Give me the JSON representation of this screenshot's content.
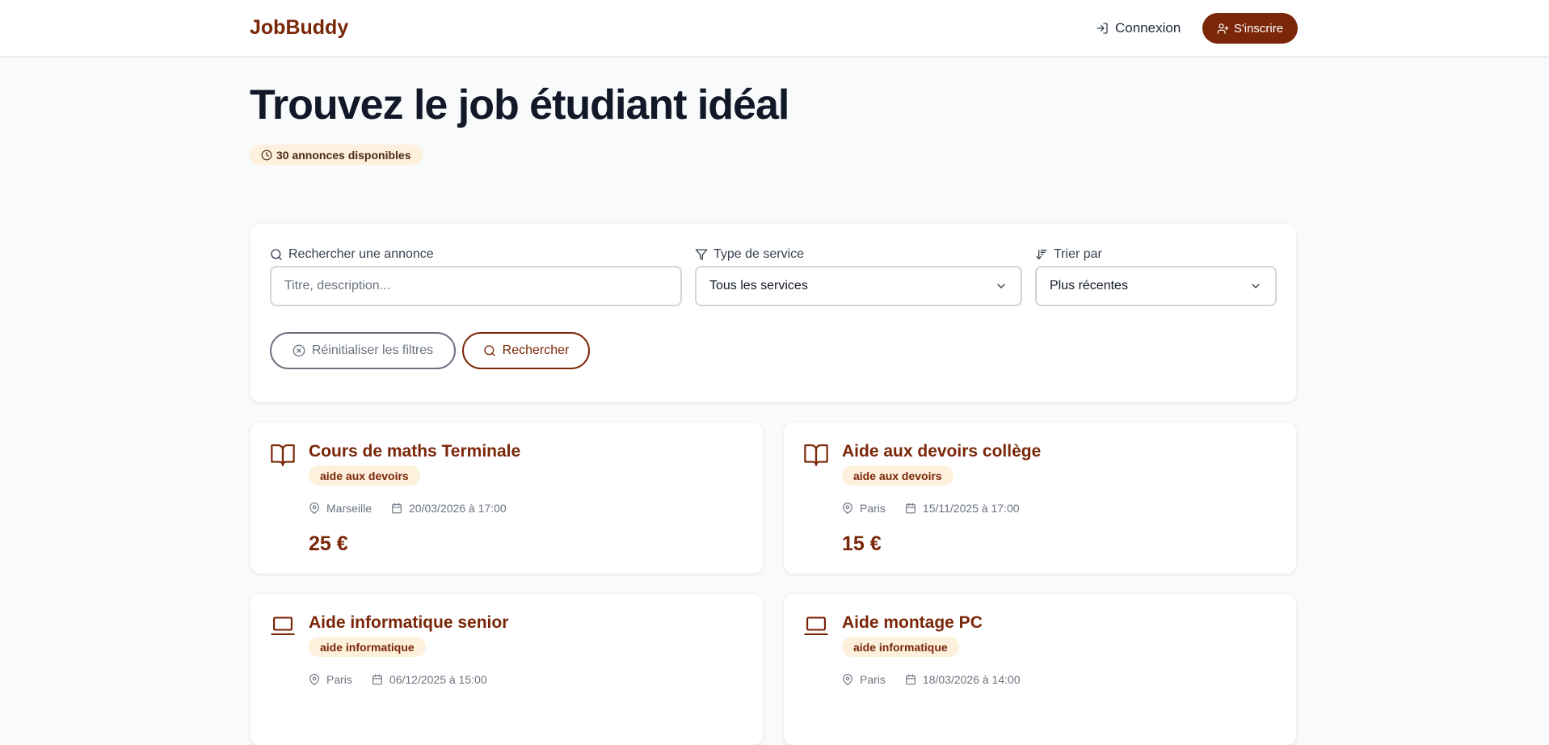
{
  "brand": "JobBuddy",
  "nav": {
    "login_label": "Connexion",
    "signup_label": "S'inscrire"
  },
  "hero": {
    "title": "Trouvez le job étudiant idéal",
    "count_badge": "30 annonces disponibles"
  },
  "filters": {
    "search_label": "Rechercher une annonce",
    "search_placeholder": "Titre, description...",
    "type_label": "Type de service",
    "type_value": "Tous les services",
    "sort_label": "Trier par",
    "sort_value": "Plus récentes",
    "reset_label": "Réinitialiser les filtres",
    "search_button_label": "Rechercher"
  },
  "jobs": [
    {
      "icon": "book-icon",
      "title": "Cours de maths Terminale",
      "tag": "aide aux devoirs",
      "city": "Marseille",
      "date": "20/03/2026 à 17:00",
      "price": "25 €"
    },
    {
      "icon": "book-icon",
      "title": "Aide aux devoirs collège",
      "tag": "aide aux devoirs",
      "city": "Paris",
      "date": "15/11/2025 à 17:00",
      "price": "15 €"
    },
    {
      "icon": "laptop-icon",
      "title": "Aide informatique senior",
      "tag": "aide informatique",
      "city": "Paris",
      "date": "06/12/2025 à 15:00",
      "price": ""
    },
    {
      "icon": "laptop-icon",
      "title": "Aide montage PC",
      "tag": "aide informatique",
      "city": "Paris",
      "date": "18/03/2026 à 14:00",
      "price": ""
    }
  ],
  "colors": {
    "brand": "#7a2608",
    "badge_bg": "#fdf0dc",
    "page_bg": "#f9fafb",
    "muted": "#6b7280"
  }
}
